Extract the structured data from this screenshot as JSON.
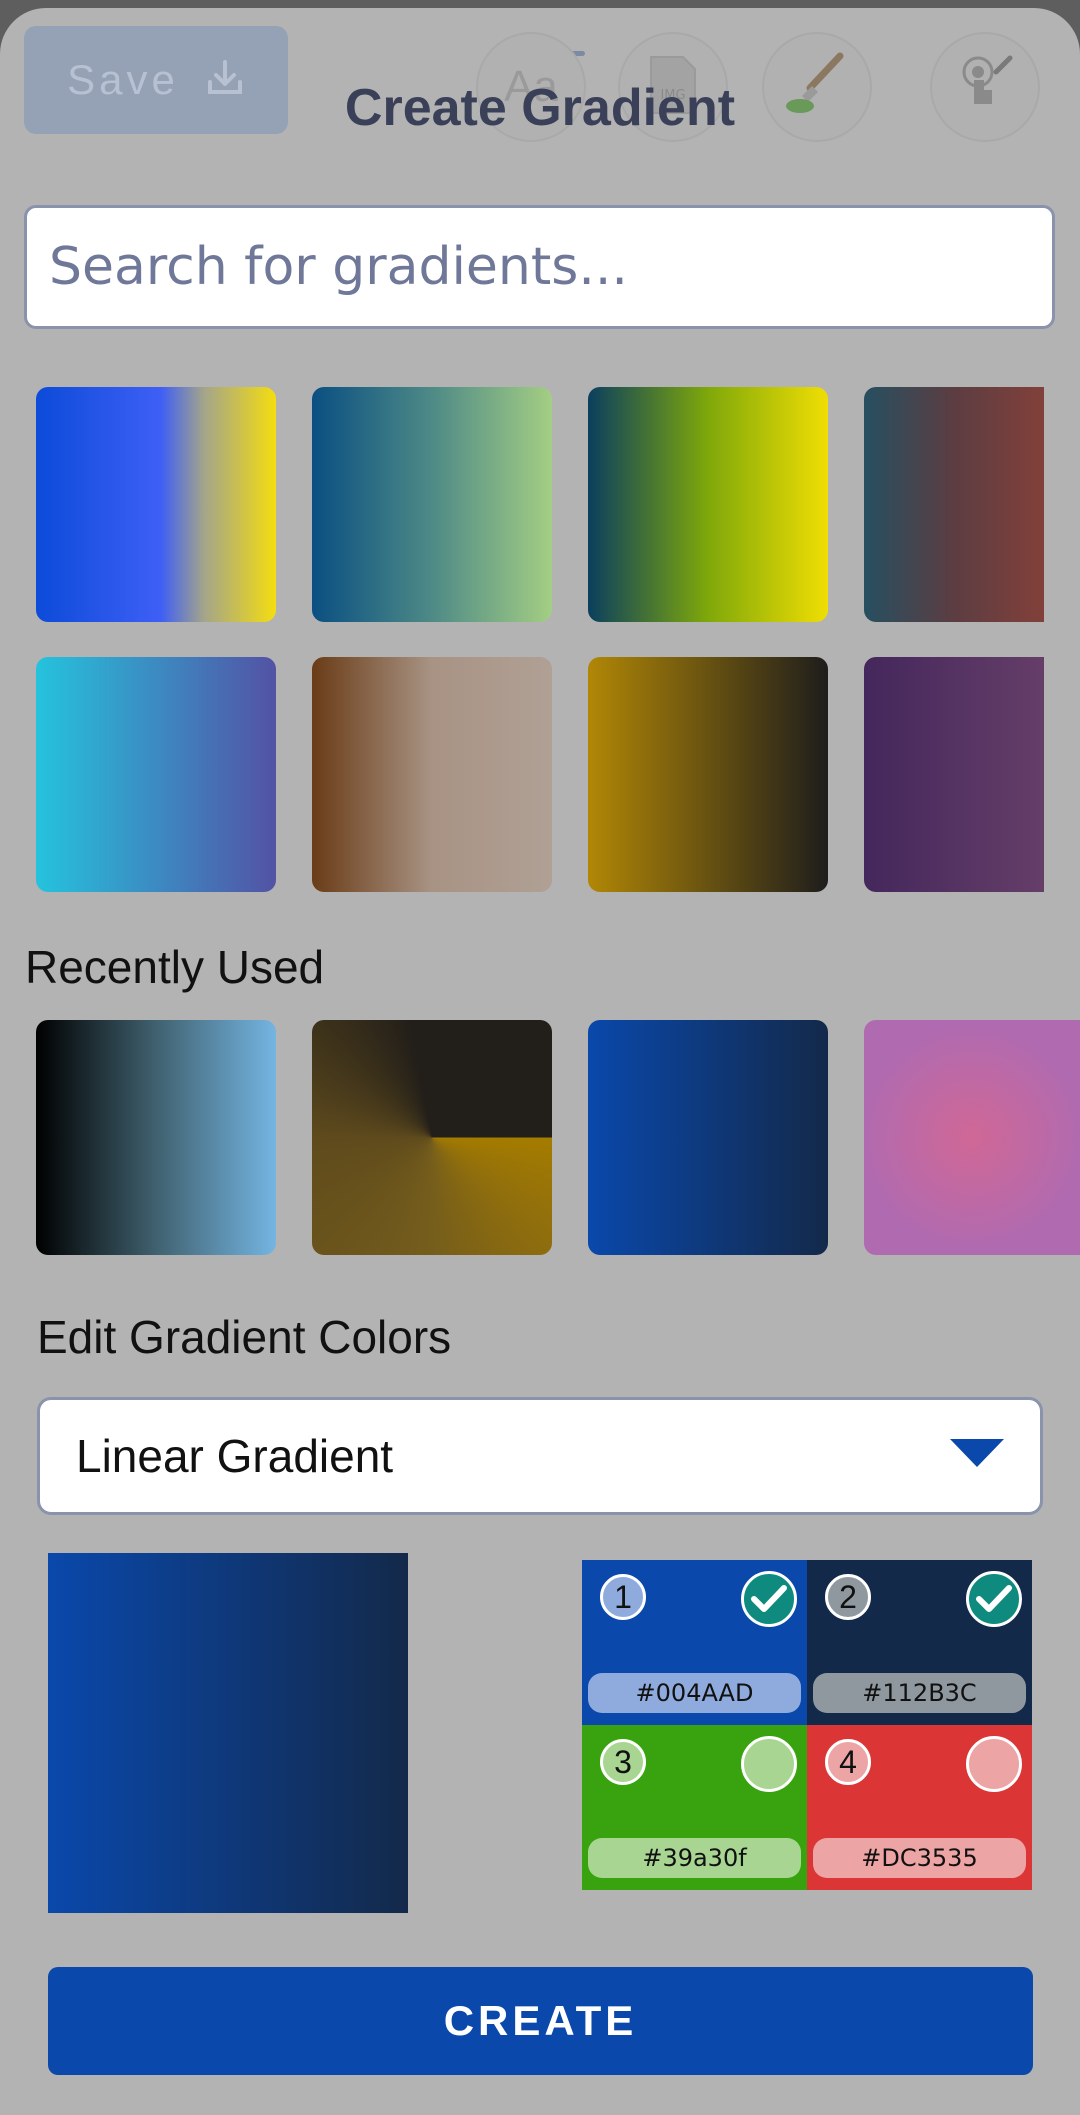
{
  "header": {
    "save_label": "Save",
    "title": "Create Gradient",
    "tool_text_icon": "Aa",
    "tool_image_icon": "IMG"
  },
  "search": {
    "placeholder": "Search for gradients..."
  },
  "gradients": [
    {
      "css": "linear-gradient(to right, #0c4bd9 0%, #3e5ff5 52%, #a4a58a 70%, #f4dd10 100%)"
    },
    {
      "css": "linear-gradient(to right, #0a4f82, #4e8a86, #a4ce84)"
    },
    {
      "css": "linear-gradient(to right, #0b3f5e, #7fa80a 50%, #f0de04)"
    },
    {
      "css": "linear-gradient(to right, #264f60, #5c3d42, #82403a)"
    },
    {
      "css": "linear-gradient(to right, #25c3dd, #5352a5)"
    },
    {
      "css": "linear-gradient(to right, #6a3c17, #a89384, #b0a095)"
    },
    {
      "css": "linear-gradient(to right, #b18706, #1e1d1c)"
    },
    {
      "css": "linear-gradient(to right, #44275c, #653e68)"
    }
  ],
  "recent": {
    "heading": "Recently Used",
    "items": [
      {
        "css": "linear-gradient(to right, #000000, #40616f 50%, #74b5e2)"
      },
      {
        "css": "conic-gradient(from 90deg at 50% 50%, #a57c00 0deg, #755d1c 90deg, #5e4a1c 180deg, #221e19 260deg, #221e19 360deg)"
      },
      {
        "css": "linear-gradient(to right, #0a48ab, #13294a)"
      },
      {
        "css": "radial-gradient(circle at 50% 50%, #d06896, #b06ab0 70%)"
      }
    ]
  },
  "editor": {
    "heading": "Edit Gradient Colors",
    "dropdown_value": "Linear Gradient",
    "preview_css": "linear-gradient(to right, #0a48ab, #13294a)",
    "stops": [
      {
        "num": "1",
        "hex": "#004AAD",
        "bg": "#0a48ab",
        "badge": "#8fabde",
        "selected": true
      },
      {
        "num": "2",
        "hex": "#112B3C",
        "bg": "#13294a",
        "badge": "#8f989f",
        "selected": true
      },
      {
        "num": "3",
        "hex": "#39a30f",
        "bg": "#38a30f",
        "badge": "#a8d592",
        "selected": false
      },
      {
        "num": "4",
        "hex": "#DC3535",
        "bg": "#dc3535",
        "badge": "#eda4a4",
        "selected": false
      }
    ]
  },
  "actions": {
    "create_label": "CREATE"
  },
  "colors": {
    "accent": "#0a48ab",
    "check_teal": "#0f8a7e"
  }
}
